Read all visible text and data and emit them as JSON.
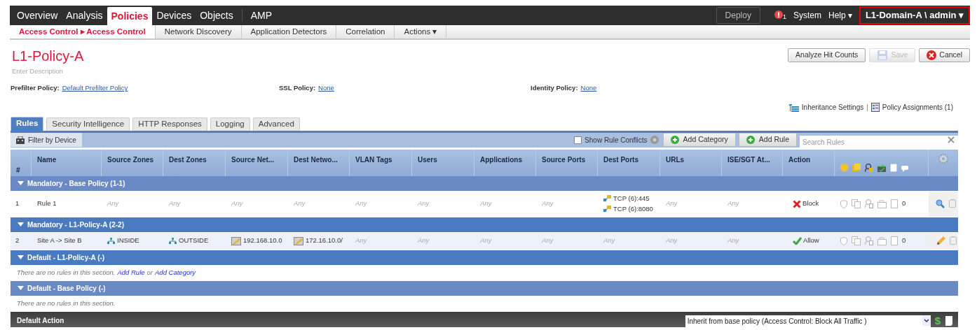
{
  "nav": {
    "tabs": [
      {
        "label": "Overview",
        "selected": false
      },
      {
        "label": "Analysis",
        "selected": false
      },
      {
        "label": "Policies",
        "selected": true
      },
      {
        "label": "Devices",
        "selected": false
      },
      {
        "label": "Objects",
        "selected": false
      },
      {
        "label": "AMP",
        "selected": false
      }
    ],
    "deploy": "Deploy",
    "alert_count": "1",
    "system": "System",
    "help": "Help ▾",
    "user": "L1-Domain-A \\ admin ▾"
  },
  "subnav": [
    {
      "label": "Access Control ▸ Access Control",
      "selected": true
    },
    {
      "label": "Network Discovery",
      "selected": false
    },
    {
      "label": "Application Detectors",
      "selected": false
    },
    {
      "label": "Correlation",
      "selected": false
    },
    {
      "label": "Actions ▾",
      "selected": false
    }
  ],
  "policy": {
    "name": "L1-Policy-A",
    "description_placeholder": "Enter Description",
    "buttons": [
      {
        "label": "Analyze Hit Counts",
        "kind": "plain",
        "disabled": false
      },
      {
        "label": "Save",
        "kind": "save",
        "disabled": true
      },
      {
        "label": "Cancel",
        "kind": "cancel",
        "disabled": false
      }
    ],
    "settings": [
      {
        "label": "Prefilter Policy:",
        "value": "Default Prefilter Policy"
      },
      {
        "label": "SSL Policy:",
        "value": "None"
      },
      {
        "label": "Identity Policy:",
        "value": "None"
      }
    ],
    "inheritance_link": "Inheritance Settings",
    "separator": "|",
    "assignments_link": "Policy Assignments (1)"
  },
  "tabs": [
    {
      "label": "Rules",
      "selected": true
    },
    {
      "label": "Security Intelligence",
      "selected": false
    },
    {
      "label": "HTTP Responses",
      "selected": false
    },
    {
      "label": "Logging",
      "selected": false
    },
    {
      "label": "Advanced",
      "selected": false
    }
  ],
  "toolbar": {
    "filter": "Filter by Device",
    "show_conflicts": {
      "label": "Show Rule Conflicts",
      "checked": false
    },
    "add_category": "Add Category",
    "add_rule": "Add Rule",
    "search_placeholder": "Search Rules"
  },
  "columns": [
    "#",
    "Name",
    "Source Zones",
    "Dest Zones",
    "Source Net...",
    "Dest Netwo...",
    "VLAN Tags",
    "Users",
    "Applications",
    "Source Ports",
    "Dest Ports",
    "URLs",
    "ISE/SGT At...",
    "Action"
  ],
  "sections": [
    {
      "title": "Mandatory - Base Policy (1-1)",
      "expanded": true,
      "inherited": true,
      "rules": [
        {
          "number": "1",
          "name": "Rule 1",
          "selected": false,
          "editable": false,
          "hits": "0",
          "action": {
            "label": "Block",
            "kind": "block"
          },
          "cells": [
            [
              {
                "kind": "any",
                "text": "Any"
              }
            ],
            [
              {
                "kind": "any",
                "text": "Any"
              }
            ],
            [
              {
                "kind": "any",
                "text": "Any"
              }
            ],
            [
              {
                "kind": "any",
                "text": "Any"
              }
            ],
            [
              {
                "kind": "any",
                "text": "Any"
              }
            ],
            [
              {
                "kind": "any",
                "text": "Any"
              }
            ],
            [
              {
                "kind": "any",
                "text": "Any"
              }
            ],
            [
              {
                "kind": "any",
                "text": "Any"
              }
            ],
            [
              {
                "kind": "port",
                "text": "TCP (6):445"
              },
              {
                "kind": "port",
                "text": "TCP (6):8080"
              }
            ],
            [
              {
                "kind": "any",
                "text": "Any"
              }
            ],
            [
              {
                "kind": "any",
                "text": "Any"
              }
            ]
          ]
        }
      ]
    },
    {
      "title": "Mandatory - L1-Policy-A (2-2)",
      "expanded": true,
      "inherited": false,
      "rules": [
        {
          "number": "2",
          "name": "Site A -> Site B",
          "selected": true,
          "editable": true,
          "hits": "0",
          "action": {
            "label": "Allow",
            "kind": "allow"
          },
          "cells": [
            [
              {
                "kind": "zone",
                "text": "INSIDE"
              }
            ],
            [
              {
                "kind": "zone",
                "text": "OUTSIDE"
              }
            ],
            [
              {
                "kind": "network",
                "text": "192.168.10.0"
              }
            ],
            [
              {
                "kind": "network",
                "text": "172.16.10.0/"
              }
            ],
            [
              {
                "kind": "any",
                "text": "Any"
              }
            ],
            [
              {
                "kind": "any",
                "text": "Any"
              }
            ],
            [
              {
                "kind": "any",
                "text": "Any"
              }
            ],
            [
              {
                "kind": "any",
                "text": "Any"
              }
            ],
            [
              {
                "kind": "any",
                "text": "Any"
              }
            ],
            [
              {
                "kind": "any",
                "text": "Any"
              }
            ],
            [
              {
                "kind": "any",
                "text": "Any"
              }
            ]
          ]
        }
      ]
    },
    {
      "title": "Default - L1-Policy-A (-)",
      "expanded": true,
      "inherited": false,
      "empty_text": "There are no rules in this section.",
      "add_rule_link": "Add Rule",
      "or": "or",
      "add_category_link": "Add Category"
    },
    {
      "title": "Default - Base Policy (-)",
      "expanded": true,
      "inherited": true,
      "empty_text": "There are no rules in this section."
    }
  ],
  "default_action": {
    "label": "Default Action",
    "variable_symbol": "$",
    "value": "Inherit from base policy (Access Control: Block All Traffic )"
  }
}
